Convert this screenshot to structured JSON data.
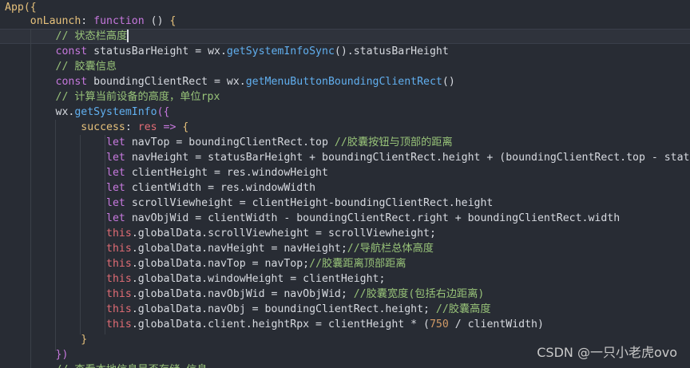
{
  "lines": [
    [
      {
        "t": "App({",
        "c": "t-id"
      }
    ],
    [
      {
        "t": "    onLaunch",
        "c": "t-prop"
      },
      {
        "t": ": ",
        "c": "t-plain"
      },
      {
        "t": "function",
        "c": "t-kw"
      },
      {
        "t": " () ",
        "c": "t-plain"
      },
      {
        "t": "{",
        "c": "t-br"
      }
    ],
    [
      {
        "t": "        // 状态栏高度",
        "c": "t-cm"
      }
    ],
    [
      {
        "t": "        ",
        "c": "t-plain"
      },
      {
        "t": "const",
        "c": "t-kw"
      },
      {
        "t": " statusBarHeight = wx.",
        "c": "t-plain"
      },
      {
        "t": "getSystemInfoSync",
        "c": "t-fn"
      },
      {
        "t": "().statusBarHeight",
        "c": "t-plain"
      }
    ],
    [
      {
        "t": "        // 胶囊信息",
        "c": "t-cm"
      }
    ],
    [
      {
        "t": "        ",
        "c": "t-plain"
      },
      {
        "t": "const",
        "c": "t-kw"
      },
      {
        "t": " boundingClientRect = wx.",
        "c": "t-plain"
      },
      {
        "t": "getMenuButtonBoundingClientRect",
        "c": "t-fn"
      },
      {
        "t": "()",
        "c": "t-plain"
      }
    ],
    [
      {
        "t": "        // 计算当前设备的高度，单位rpx",
        "c": "t-cm"
      }
    ],
    [
      {
        "t": "        wx.",
        "c": "t-plain"
      },
      {
        "t": "getSystemInfo",
        "c": "t-fn"
      },
      {
        "t": "({",
        "c": "t-br2"
      }
    ],
    [
      {
        "t": "            success",
        "c": "t-prop"
      },
      {
        "t": ": ",
        "c": "t-plain"
      },
      {
        "t": "res",
        "c": "t-param"
      },
      {
        "t": " => ",
        "c": "t-kw"
      },
      {
        "t": "{",
        "c": "t-br"
      }
    ],
    [
      {
        "t": "                ",
        "c": "t-plain"
      },
      {
        "t": "let",
        "c": "t-kw"
      },
      {
        "t": " navTop = boundingClientRect.top ",
        "c": "t-plain"
      },
      {
        "t": "//胶囊按钮与顶部的距离",
        "c": "t-cm"
      }
    ],
    [
      {
        "t": "                ",
        "c": "t-plain"
      },
      {
        "t": "let",
        "c": "t-kw"
      },
      {
        "t": " navHeight = statusBarHeight + boundingClientRect.height + (boundingClientRect.top - statusBa",
        "c": "t-plain"
      }
    ],
    [
      {
        "t": "                ",
        "c": "t-plain"
      },
      {
        "t": "let",
        "c": "t-kw"
      },
      {
        "t": " clientHeight = res.windowHeight",
        "c": "t-plain"
      }
    ],
    [
      {
        "t": "                ",
        "c": "t-plain"
      },
      {
        "t": "let",
        "c": "t-kw"
      },
      {
        "t": " clientWidth = res.windowWidth",
        "c": "t-plain"
      }
    ],
    [
      {
        "t": "                ",
        "c": "t-plain"
      },
      {
        "t": "let",
        "c": "t-kw"
      },
      {
        "t": " scrollViewheight = clientHeight-boundingClientRect.height",
        "c": "t-plain"
      }
    ],
    [
      {
        "t": "                ",
        "c": "t-plain"
      },
      {
        "t": "let",
        "c": "t-kw"
      },
      {
        "t": " navObjWid = clientWidth - boundingClientRect.right + boundingClientRect.width",
        "c": "t-plain"
      }
    ],
    [
      {
        "t": "                ",
        "c": "t-plain"
      },
      {
        "t": "this",
        "c": "t-this"
      },
      {
        "t": ".globalData.scrollViewheight = scrollViewheight;",
        "c": "t-plain"
      }
    ],
    [
      {
        "t": "                ",
        "c": "t-plain"
      },
      {
        "t": "this",
        "c": "t-this"
      },
      {
        "t": ".globalData.navHeight = navHeight;",
        "c": "t-plain"
      },
      {
        "t": "//导航栏总体高度",
        "c": "t-cm"
      }
    ],
    [
      {
        "t": "                ",
        "c": "t-plain"
      },
      {
        "t": "this",
        "c": "t-this"
      },
      {
        "t": ".globalData.navTop = navTop;",
        "c": "t-plain"
      },
      {
        "t": "//胶囊距离顶部距离",
        "c": "t-cm"
      }
    ],
    [
      {
        "t": "                ",
        "c": "t-plain"
      },
      {
        "t": "this",
        "c": "t-this"
      },
      {
        "t": ".globalData.windowHeight = clientHeight;",
        "c": "t-plain"
      }
    ],
    [
      {
        "t": "                ",
        "c": "t-plain"
      },
      {
        "t": "this",
        "c": "t-this"
      },
      {
        "t": ".globalData.navObjWid = navObjWid; ",
        "c": "t-plain"
      },
      {
        "t": "//胶囊宽度(包括右边距离)",
        "c": "t-cm"
      }
    ],
    [
      {
        "t": "                ",
        "c": "t-plain"
      },
      {
        "t": "this",
        "c": "t-this"
      },
      {
        "t": ".globalData.navObj = boundingClientRect.height; ",
        "c": "t-plain"
      },
      {
        "t": "//胶囊高度",
        "c": "t-cm"
      }
    ],
    [
      {
        "t": "                ",
        "c": "t-plain"
      },
      {
        "t": "this",
        "c": "t-this"
      },
      {
        "t": ".globalData.client.heightRpx = clientHeight * (",
        "c": "t-plain"
      },
      {
        "t": "750",
        "c": "t-num"
      },
      {
        "t": " / clientWidth)",
        "c": "t-plain"
      }
    ],
    [
      {
        "t": "            }",
        "c": "t-br"
      }
    ],
    [
      {
        "t": "        })",
        "c": "t-br2"
      }
    ],
    [
      {
        "t": "        // 查看本地信息是否存储 信息",
        "c": "t-cm"
      }
    ]
  ],
  "watermark": "CSDN @一只小老虎ovo"
}
